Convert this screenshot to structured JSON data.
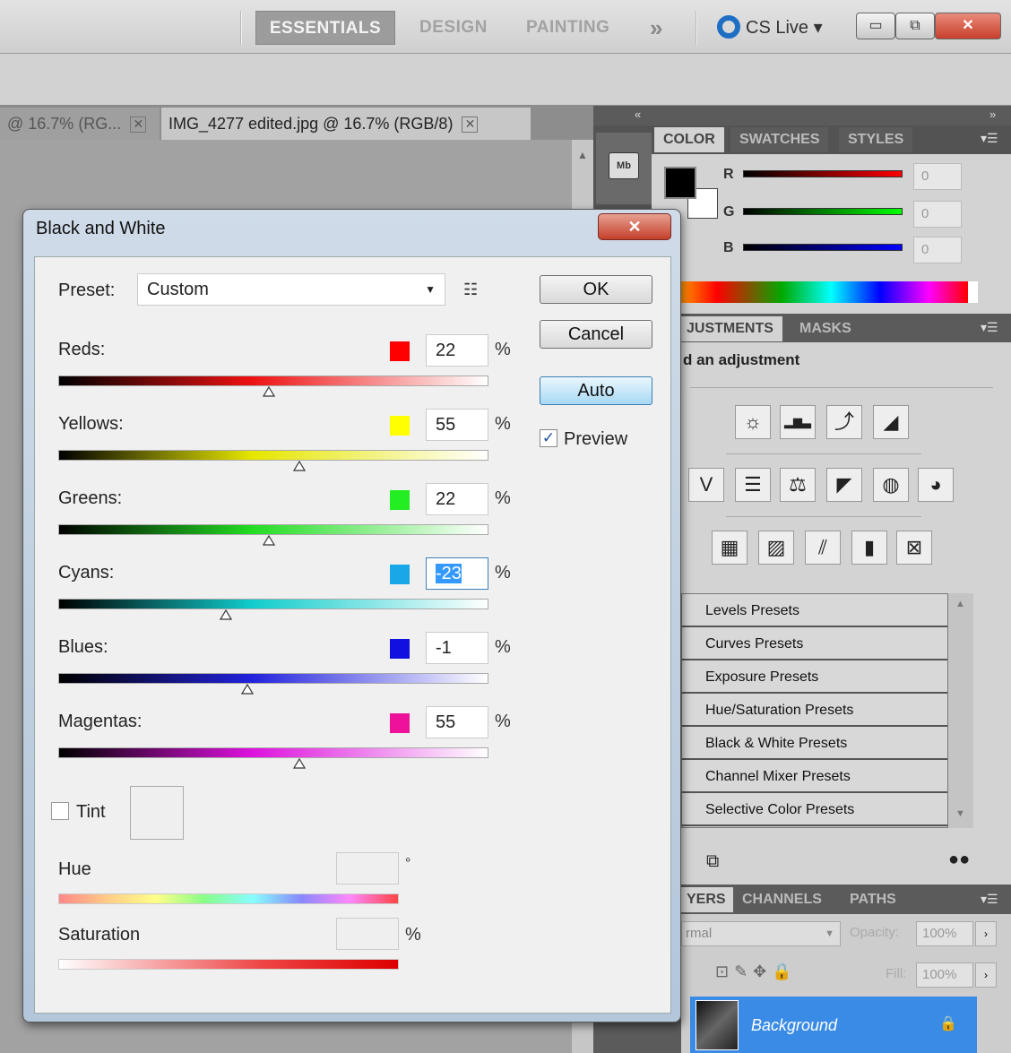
{
  "workspace": {
    "tabs": [
      "ESSENTIALS",
      "DESIGN",
      "PAINTING"
    ],
    "more": "»",
    "cs_live": "CS Live ▾"
  },
  "window_controls": {
    "minimize": "▭",
    "restore": "⧉",
    "close": "✕"
  },
  "document_tabs": [
    {
      "label": "@ 16.7% (RG...",
      "close": "✕"
    },
    {
      "label": "IMG_4277 edited.jpg @ 16.7% (RGB/8)",
      "close": "✕"
    }
  ],
  "color_panel": {
    "tabs": [
      "COLOR",
      "SWATCHES",
      "STYLES"
    ],
    "channels": [
      {
        "label": "R",
        "value": "0",
        "gradient": "linear-gradient(90deg,#000,#f00)"
      },
      {
        "label": "G",
        "value": "0",
        "gradient": "linear-gradient(90deg,#000,#0f0)"
      },
      {
        "label": "B",
        "value": "0",
        "gradient": "linear-gradient(90deg,#000,#00f)"
      }
    ]
  },
  "adjustments_panel": {
    "tabs": [
      "JUSTMENTS",
      "MASKS"
    ],
    "hint": "d an adjustment",
    "icons_row1": [
      "☼",
      "▂▆▃",
      "⤴",
      "◢"
    ],
    "icons_row2": [
      "V",
      "☰",
      "⚖",
      "◤",
      "◍",
      "◕"
    ],
    "icons_row3": [
      "▦",
      "▨",
      "⫽",
      "▮",
      "⊠"
    ],
    "presets": [
      "Levels Presets",
      "Curves Presets",
      "Exposure Presets",
      "Hue/Saturation Presets",
      "Black & White Presets",
      "Channel Mixer Presets",
      "Selective Color Presets"
    ]
  },
  "layers_panel": {
    "tabs": [
      "YERS",
      "CHANNELS",
      "PATHS"
    ],
    "blend_mode": "rmal",
    "opacity_label": "Opacity:",
    "opacity": "100%",
    "fill_label": "Fill:",
    "fill": "100%",
    "layer_name": "Background"
  },
  "dialog": {
    "title": "Black and White",
    "close": "✕",
    "preset_label": "Preset:",
    "preset_value": "Custom",
    "buttons": {
      "ok": "OK",
      "cancel": "Cancel",
      "auto": "Auto"
    },
    "preview_label": "Preview",
    "preview_checked": true,
    "pct": "%",
    "channels": [
      {
        "label": "Reds:",
        "value": "22",
        "color": "#ff0000",
        "gradient": "linear-gradient(90deg,#000,#ee1111 45%,#fff)",
        "level": 0.49
      },
      {
        "label": "Yellows:",
        "value": "55",
        "color": "#ffff00",
        "gradient": "linear-gradient(90deg,#000,#e6e600 45%,#fff)",
        "level": 0.56
      },
      {
        "label": "Greens:",
        "value": "22",
        "color": "#22ee22",
        "gradient": "linear-gradient(90deg,#000,#22dd22 45%,#fff)",
        "level": 0.49
      },
      {
        "label": "Cyans:",
        "value": "-23",
        "color": "#18a8e8",
        "gradient": "linear-gradient(90deg,#000,#11cccc 45%,#fff)",
        "level": 0.39
      },
      {
        "label": "Blues:",
        "value": "-1",
        "color": "#1010e0",
        "gradient": "linear-gradient(90deg,#000,#2222dd 45%,#fff)",
        "level": 0.44
      },
      {
        "label": "Magentas:",
        "value": "55",
        "color": "#ee1199",
        "gradient": "linear-gradient(90deg,#000,#dd11dd 45%,#fff)",
        "level": 0.56
      }
    ],
    "tint_label": "Tint",
    "hue_label": "Hue",
    "hue_unit": "°",
    "saturation_label": "Saturation",
    "sat_unit": "%"
  }
}
